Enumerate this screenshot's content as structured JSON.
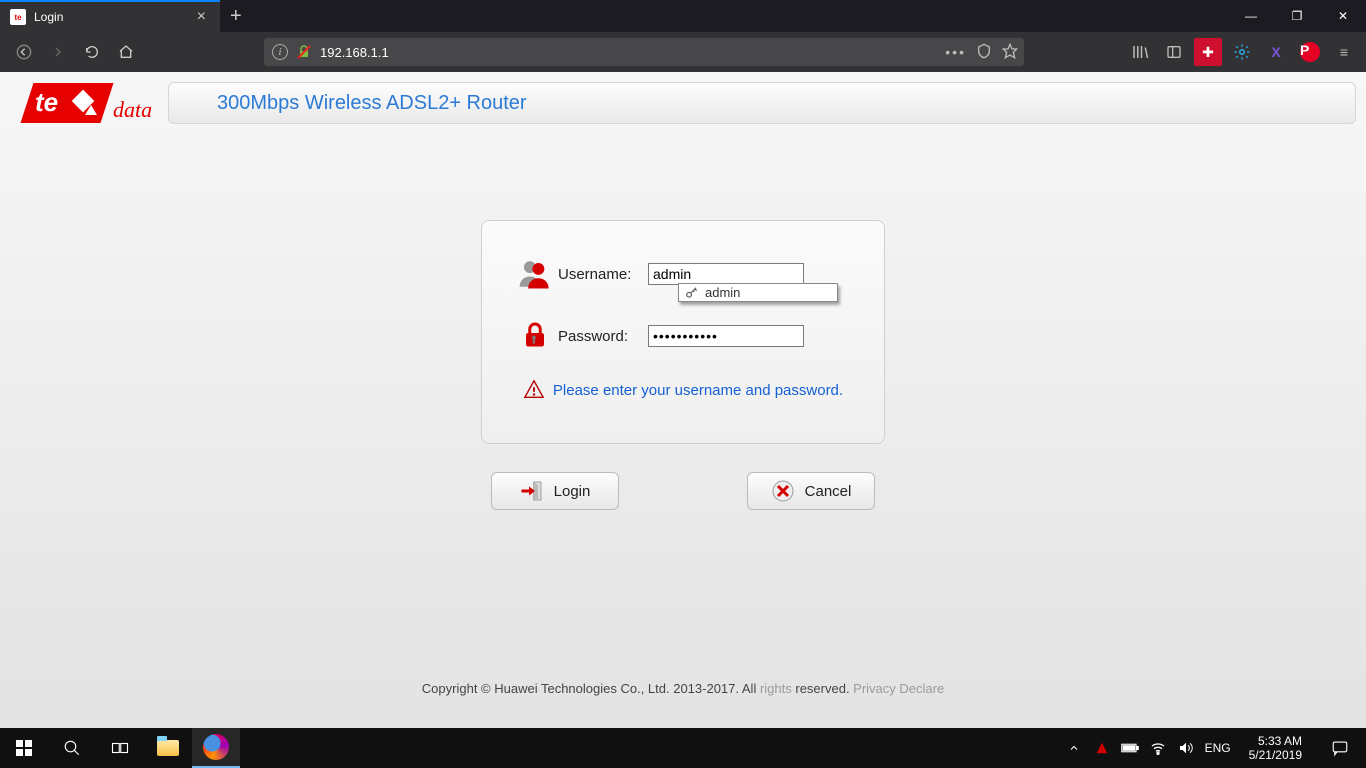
{
  "browser": {
    "tab_title": "Login",
    "url": "192.168.1.1"
  },
  "page": {
    "brand_prefix": "te",
    "brand_suffix": "data",
    "title": "300Mbps Wireless ADSL2+ Router",
    "username_label": "Username:",
    "username_value": "admin",
    "autocomplete_option": "admin",
    "password_label": "Password:",
    "password_value": "•••••••••••",
    "prompt": "Please enter your username and password.",
    "login_btn": "Login",
    "cancel_btn": "Cancel",
    "footer_prefix": "Copyright © Huawei Technologies Co., Ltd. 2013-2017. All ",
    "footer_rights": "rights",
    "footer_reserved": " reserved. ",
    "footer_privacy": "Privacy Declare"
  },
  "taskbar": {
    "lang": "ENG",
    "time": "5:33 AM",
    "date": "5/21/2019"
  }
}
